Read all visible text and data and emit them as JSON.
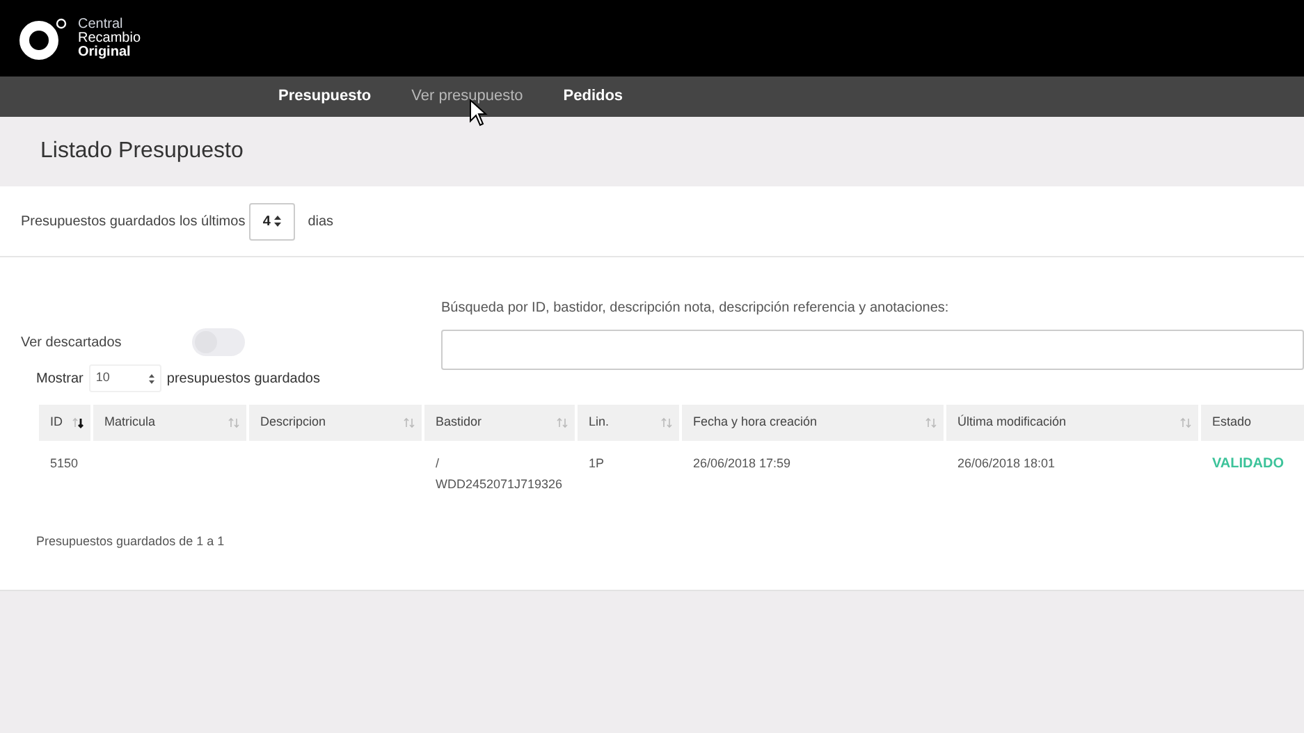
{
  "logo": {
    "lines": [
      "Central",
      "Recambio",
      "Original"
    ]
  },
  "nav": [
    {
      "label": "Presupuesto",
      "hovered": false
    },
    {
      "label": "Ver presupuesto",
      "hovered": true
    },
    {
      "label": "Pedidos",
      "hovered": false
    }
  ],
  "page_title": "Listado Presupuesto",
  "days_filter": {
    "label": "Presupuestos guardados los últimos",
    "value": "4",
    "suffix": "dias"
  },
  "discarded_toggle": {
    "label": "Ver descartados",
    "on": false
  },
  "search": {
    "label": "Búsqueda por ID, bastidor, descripción nota, descripción referencia y anotaciones:"
  },
  "page_size": {
    "label": "Mostrar",
    "value": "10",
    "suffix": "presupuestos guardados"
  },
  "table": {
    "columns": [
      {
        "label": "ID",
        "sortable": true,
        "sorted": true
      },
      {
        "label": "Matricula",
        "sortable": true,
        "sorted": false
      },
      {
        "label": "Descripcion",
        "sortable": true,
        "sorted": false
      },
      {
        "label": "Bastidor",
        "sortable": true,
        "sorted": false
      },
      {
        "label": "Lin.",
        "sortable": true,
        "sorted": false
      },
      {
        "label": "Fecha y hora creación",
        "sortable": true,
        "sorted": false
      },
      {
        "label": "Última modificación",
        "sortable": true,
        "sorted": false
      },
      {
        "label": "Estado",
        "sortable": false
      }
    ],
    "rows": [
      {
        "cells": [
          "5150",
          "",
          "",
          "/\nWDD2452071J719326",
          "1P",
          "26/06/2018 17:59",
          "26/06/2018 18:01",
          "VALIDADO"
        ],
        "color": "#3cc39a"
      }
    ]
  },
  "footer_info": "Presupuestos guardados de 1 a 1"
}
